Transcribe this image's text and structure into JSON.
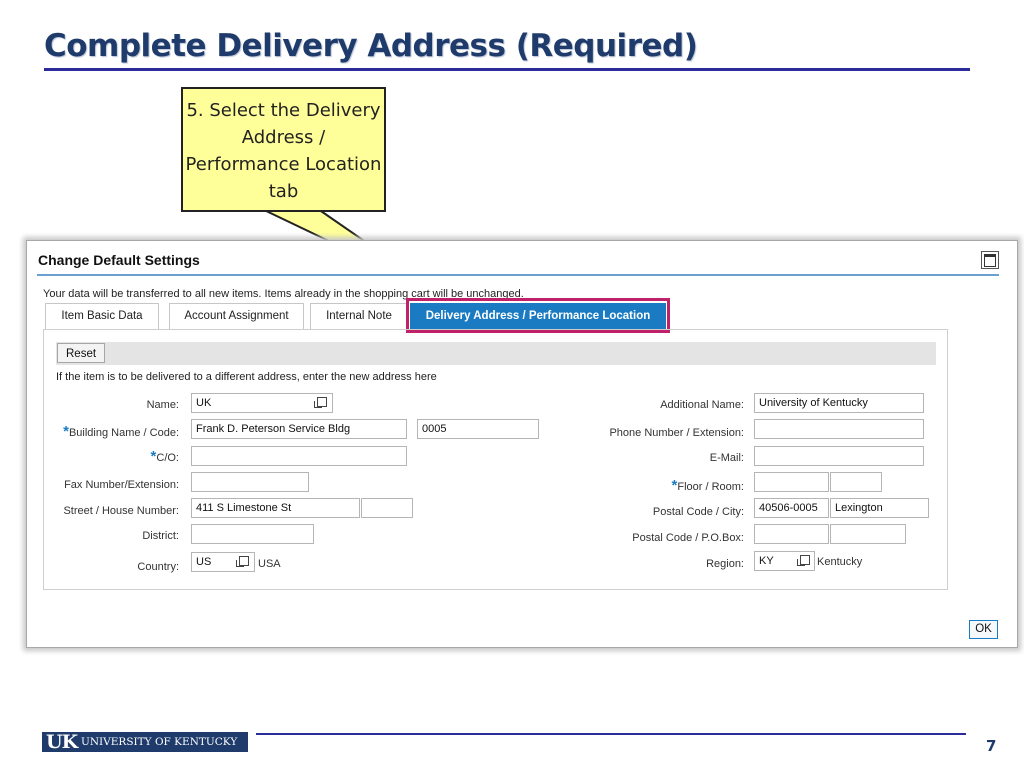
{
  "slide": {
    "title": "Complete Delivery Address (Required)",
    "callout_text": "5. Select the Delivery Address / Performance Location tab",
    "page_number": "7",
    "logo_text": "UK UNIVERSITY OF KENTUCKY"
  },
  "dialog": {
    "title": "Change Default Settings",
    "info_text": "Your data will be transferred to all new items. Items already in the shopping cart will be unchanged.",
    "tabs": [
      {
        "label": "Item Basic Data"
      },
      {
        "label": "Account Assignment"
      },
      {
        "label": "Internal Note"
      },
      {
        "label": "Delivery Address / Performance Location",
        "active": true
      }
    ],
    "reset_label": "Reset",
    "instruction": "If the item is to be delivered to a different address, enter the new address here",
    "ok_label": "OK",
    "highlight_color": "#c0226a",
    "active_tab_color": "#1a7bc2"
  },
  "form": {
    "left": {
      "name": {
        "label": "Name:",
        "value": "UK"
      },
      "building": {
        "label": "Building Name / Code:",
        "value": "Frank D. Peterson Service Bldg",
        "code": "0005",
        "required": true
      },
      "co": {
        "label": "C/O:",
        "value": "",
        "required": true
      },
      "fax": {
        "label": "Fax Number/Extension:",
        "value": ""
      },
      "street": {
        "label": "Street / House Number:",
        "value": "411 S Limestone St",
        "house": ""
      },
      "district": {
        "label": "District:",
        "value": ""
      },
      "country": {
        "label": "Country:",
        "value": "US",
        "desc": "USA"
      }
    },
    "right": {
      "additional_name": {
        "label": "Additional Name:",
        "value": "University of Kentucky"
      },
      "phone": {
        "label": "Phone Number / Extension:",
        "value": ""
      },
      "email": {
        "label": "E-Mail:",
        "value": ""
      },
      "floor_room": {
        "label": "Floor / Room:",
        "floor": "",
        "room": "",
        "required": true
      },
      "postal_city": {
        "label": "Postal Code / City:",
        "postal": "40506-0005",
        "city": "Lexington"
      },
      "po_box": {
        "label": "Postal Code / P.O.Box:",
        "postal": "",
        "box": ""
      },
      "region": {
        "label": "Region:",
        "value": "KY",
        "desc": "Kentucky"
      }
    },
    "required_marker": "*",
    "icons": [
      "value-help-icon",
      "maximize-icon"
    ]
  }
}
